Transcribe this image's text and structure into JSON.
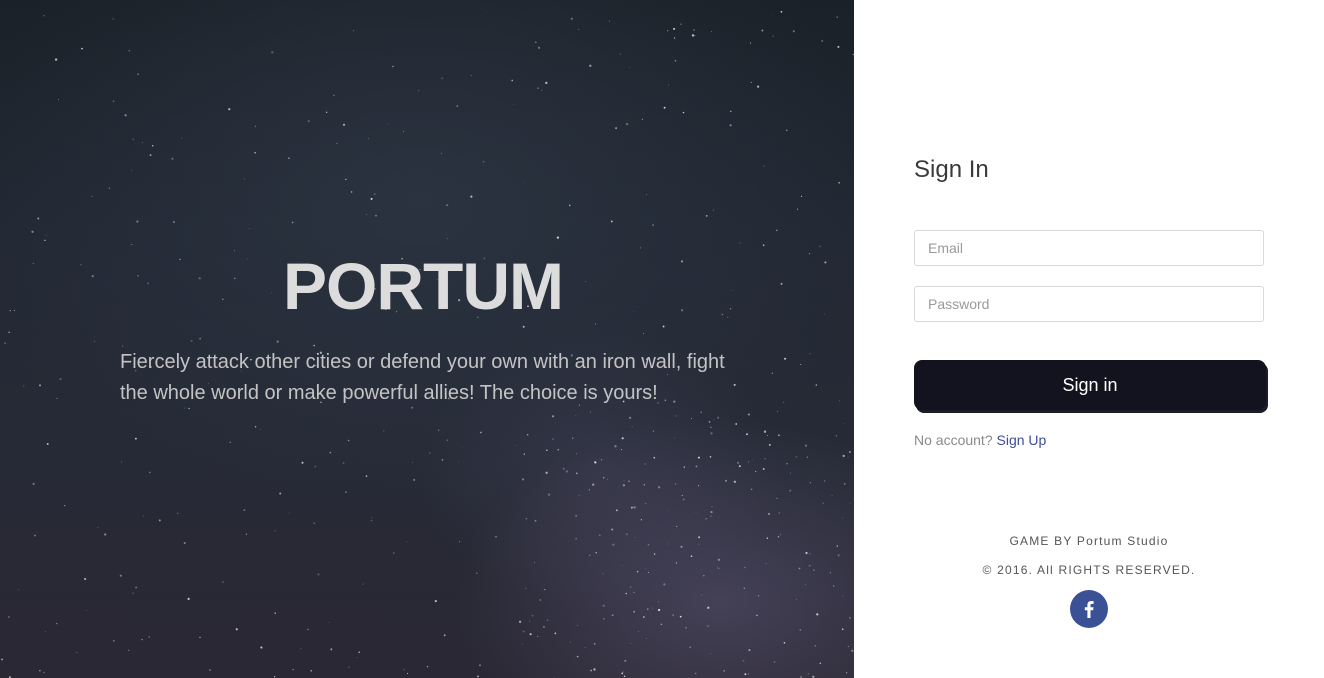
{
  "hero": {
    "title": "PORTUM",
    "tagline": "Fiercely attack other cities or defend your own with an iron wall, fight the whole world or make powerful allies! The choice is yours!"
  },
  "signin": {
    "title": "Sign In",
    "email_placeholder": "Email",
    "password_placeholder": "Password",
    "submit_label": "Sign in",
    "no_account_text": "No account?",
    "signup_link": "Sign Up"
  },
  "footer": {
    "game_by": "GAME BY Portum Studio",
    "copyright": "© 2016. All RIGHTS RESERVED.",
    "social_icon": "facebook-icon"
  },
  "colors": {
    "button_bg": "#13131f",
    "link": "#3e4d9a",
    "facebook": "#3b5196"
  }
}
